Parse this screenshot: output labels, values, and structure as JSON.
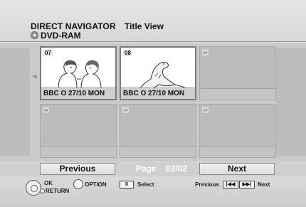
{
  "header": {
    "title": "DIRECT NAVIGATOR",
    "view": "Title View",
    "disc_label": "DVD-RAM",
    "disc_icon": "disc-icon"
  },
  "thumbnails": [
    {
      "number": "07",
      "caption": "BBC O 27/10 MON",
      "image": "cartoon-couple"
    },
    {
      "number": "08",
      "caption": "BBC O 27/10 MON",
      "image": "cartoon-dinosaur"
    },
    {
      "number": "--",
      "caption": ""
    },
    {
      "number": "--",
      "caption": ""
    },
    {
      "number": "--",
      "caption": ""
    },
    {
      "number": "--",
      "caption": ""
    }
  ],
  "pagination": {
    "previous_label": "Previous",
    "page_label": "Page",
    "page_value": "02/02",
    "next_label": "Next"
  },
  "footer": {
    "ok_label": "OK",
    "return_label": "RETURN",
    "option_label": "OPTION",
    "pause_key": "II",
    "select_label": "Select",
    "previous_label": "Previous",
    "skip_back_key": "|◀◀",
    "skip_fwd_key": "▶▶|",
    "next_label": "Next"
  }
}
